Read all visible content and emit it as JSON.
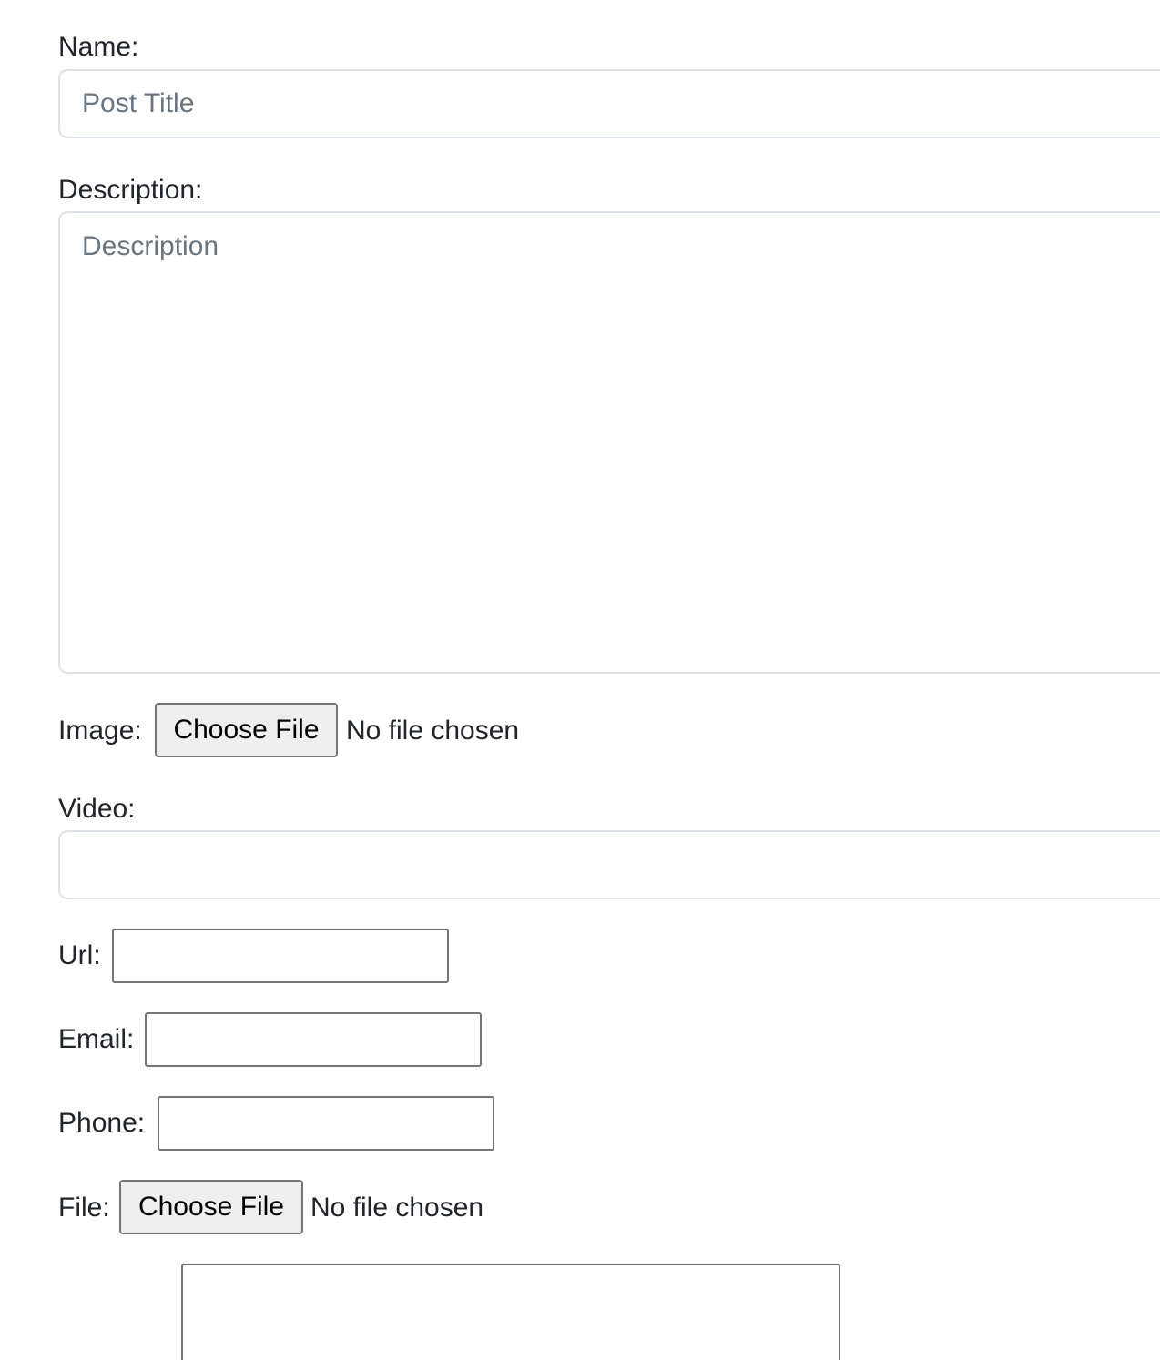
{
  "form": {
    "name": {
      "label": "Name:",
      "placeholder": "Post Title",
      "value": ""
    },
    "description": {
      "label": "Description:",
      "placeholder": "Description",
      "value": ""
    },
    "image": {
      "label": "Image:",
      "button_label": "Choose File",
      "status": "No file chosen"
    },
    "video": {
      "label": "Video:",
      "value": ""
    },
    "url": {
      "label": "Url:",
      "value": ""
    },
    "email": {
      "label": "Email:",
      "value": ""
    },
    "phone": {
      "label": "Phone:",
      "value": ""
    },
    "file": {
      "label": "File:",
      "button_label": "Choose File",
      "status": "No file chosen"
    }
  }
}
